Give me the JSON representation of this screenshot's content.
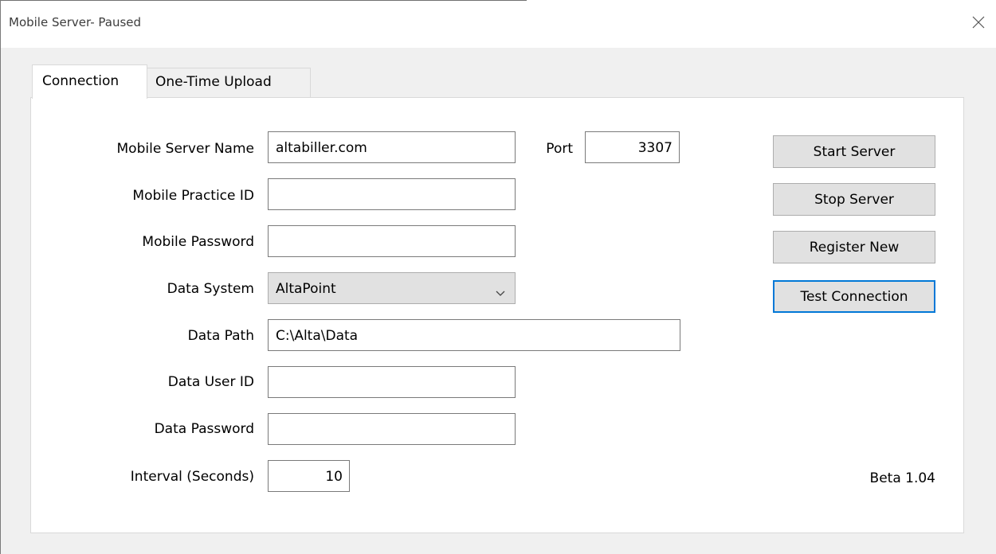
{
  "window": {
    "title": "Mobile Server- Paused",
    "close_icon": "close-icon"
  },
  "tabs": [
    {
      "label": "Connection",
      "selected": true
    },
    {
      "label": "One-Time Upload",
      "selected": false
    }
  ],
  "form": {
    "server_name": {
      "label": "Mobile Server Name",
      "value": "altabiller.com"
    },
    "port": {
      "label": "Port",
      "value": "3307"
    },
    "practice_id": {
      "label": "Mobile Practice ID",
      "value": ""
    },
    "mobile_password": {
      "label": "Mobile Password",
      "value": ""
    },
    "data_system": {
      "label": "Data System",
      "value": "AltaPoint"
    },
    "data_path": {
      "label": "Data Path",
      "value": "C:\\Alta\\Data"
    },
    "data_user_id": {
      "label": "Data User ID",
      "value": ""
    },
    "data_password": {
      "label": "Data Password",
      "value": ""
    },
    "interval": {
      "label": "Interval (Seconds)",
      "value": "10"
    }
  },
  "buttons": {
    "start_server": "Start Server",
    "stop_server": "Stop Server",
    "register_new": "Register New",
    "test_connection": "Test Connection"
  },
  "version": "Beta 1.04",
  "colors": {
    "focus_border": "#0078d7",
    "button_face": "#e1e1e1",
    "window_bg": "#f0f0f0"
  }
}
